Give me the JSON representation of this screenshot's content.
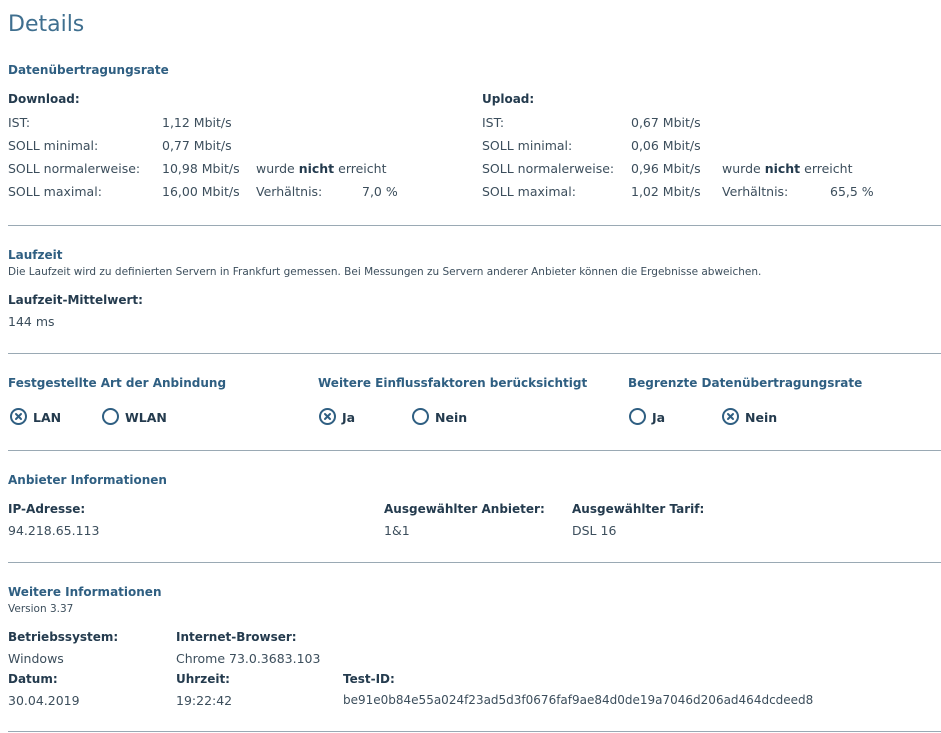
{
  "page_title": "Details",
  "rate": {
    "heading": "Datenübertragungsrate",
    "download": {
      "heading": "Download:",
      "ist_label": "IST:",
      "ist_value": "1,12 Mbit/s",
      "min_label": "SOLL minimal:",
      "min_value": "0,77 Mbit/s",
      "normal_label": "SOLL normalerweise:",
      "normal_value": "10,98 Mbit/s",
      "max_label": "SOLL maximal:",
      "max_value": "16,00 Mbit/s",
      "status_pre": "wurde",
      "status_em": "nicht",
      "status_post": "erreicht",
      "ratio_label": "Verhältnis:",
      "ratio_value": "7,0 %"
    },
    "upload": {
      "heading": "Upload:",
      "ist_label": "IST:",
      "ist_value": "0,67 Mbit/s",
      "min_label": "SOLL minimal:",
      "min_value": "0,06 Mbit/s",
      "normal_label": "SOLL normalerweise:",
      "normal_value": "0,96 Mbit/s",
      "max_label": "SOLL maximal:",
      "max_value": "1,02 Mbit/s",
      "status_pre": "wurde",
      "status_em": "nicht",
      "status_post": "erreicht",
      "ratio_label": "Verhältnis:",
      "ratio_value": "65,5 %"
    }
  },
  "latency": {
    "heading": "Laufzeit",
    "note": "Die Laufzeit wird zu definierten Servern in Frankfurt gemessen. Bei Messungen zu Servern anderer Anbieter können die Ergebnisse abweichen.",
    "avg_label": "Laufzeit-Mittelwert:",
    "avg_value": "144 ms"
  },
  "options": {
    "connection": {
      "heading": "Festgestellte Art der Anbindung",
      "opt1": "LAN",
      "opt2": "WLAN",
      "selected": "LAN"
    },
    "factors": {
      "heading": "Weitere Einflussfaktoren berücksichtigt",
      "opt1": "Ja",
      "opt2": "Nein",
      "selected": "Ja"
    },
    "limited": {
      "heading": "Begrenzte Datenübertragungsrate",
      "opt1": "Ja",
      "opt2": "Nein",
      "selected": "Nein"
    }
  },
  "provider": {
    "heading": "Anbieter Informationen",
    "ip_label": "IP-Adresse:",
    "ip_value": "94.218.65.113",
    "anbieter_label": "Ausgewählter Anbieter:",
    "anbieter_value": "1&1",
    "tarif_label": "Ausgewählter Tarif:",
    "tarif_value": "DSL 16"
  },
  "more": {
    "heading": "Weitere Informationen",
    "version": "Version 3.37",
    "os_label": "Betriebssystem:",
    "os_value": "Windows",
    "browser_label": "Internet-Browser:",
    "browser_value": "Chrome 73.0.3683.103",
    "date_label": "Datum:",
    "date_value": "30.04.2019",
    "time_label": "Uhrzeit:",
    "time_value": "19:22:42",
    "testid_label": "Test-ID:",
    "testid_value": "be91e0b84e55a024f23ad5d3f0676faf9ae84d0de19a7046d206ad464dcdeed8"
  }
}
